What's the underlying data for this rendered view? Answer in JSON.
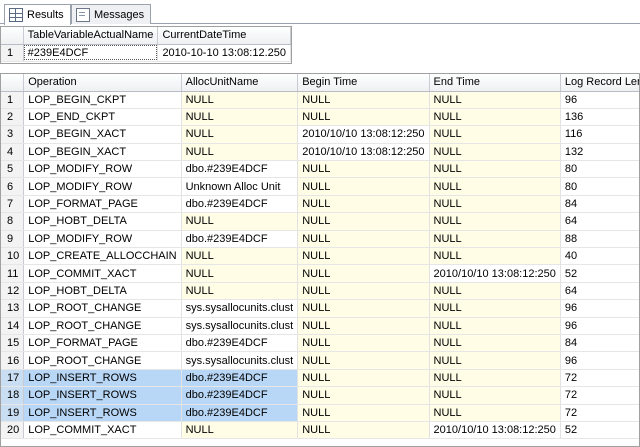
{
  "tabs": [
    {
      "label": "Results",
      "icon": "grid-icon",
      "active": true
    },
    {
      "label": "Messages",
      "icon": "messages-icon",
      "active": false
    }
  ],
  "grid1": {
    "columns": [
      "",
      "TableVariableActualName",
      "CurrentDateTime"
    ],
    "rows": [
      [
        "1",
        "#239E4DCF",
        "2010-10-10 13:08:12.250"
      ]
    ]
  },
  "grid2": {
    "columns": [
      "",
      "Operation",
      "AllocUnitName",
      "Begin Time",
      "End Time",
      "Log Record Length"
    ],
    "rows": [
      [
        "1",
        "LOP_BEGIN_CKPT",
        "NULL",
        "NULL",
        "NULL",
        "96"
      ],
      [
        "2",
        "LOP_END_CKPT",
        "NULL",
        "NULL",
        "NULL",
        "136"
      ],
      [
        "3",
        "LOP_BEGIN_XACT",
        "NULL",
        "2010/10/10 13:08:12:250",
        "NULL",
        "116"
      ],
      [
        "4",
        "LOP_BEGIN_XACT",
        "NULL",
        "2010/10/10 13:08:12:250",
        "NULL",
        "132"
      ],
      [
        "5",
        "LOP_MODIFY_ROW",
        "dbo.#239E4DCF",
        "NULL",
        "NULL",
        "80"
      ],
      [
        "6",
        "LOP_MODIFY_ROW",
        "Unknown Alloc Unit",
        "NULL",
        "NULL",
        "80"
      ],
      [
        "7",
        "LOP_FORMAT_PAGE",
        "dbo.#239E4DCF",
        "NULL",
        "NULL",
        "84"
      ],
      [
        "8",
        "LOP_HOBT_DELTA",
        "NULL",
        "NULL",
        "NULL",
        "64"
      ],
      [
        "9",
        "LOP_MODIFY_ROW",
        "dbo.#239E4DCF",
        "NULL",
        "NULL",
        "88"
      ],
      [
        "10",
        "LOP_CREATE_ALLOCCHAIN",
        "NULL",
        "NULL",
        "NULL",
        "40"
      ],
      [
        "11",
        "LOP_COMMIT_XACT",
        "NULL",
        "NULL",
        "2010/10/10 13:08:12:250",
        "52"
      ],
      [
        "12",
        "LOP_HOBT_DELTA",
        "NULL",
        "NULL",
        "NULL",
        "64"
      ],
      [
        "13",
        "LOP_ROOT_CHANGE",
        "sys.sysallocunits.clust",
        "NULL",
        "NULL",
        "96"
      ],
      [
        "14",
        "LOP_ROOT_CHANGE",
        "sys.sysallocunits.clust",
        "NULL",
        "NULL",
        "96"
      ],
      [
        "15",
        "LOP_FORMAT_PAGE",
        "dbo.#239E4DCF",
        "NULL",
        "NULL",
        "84"
      ],
      [
        "16",
        "LOP_ROOT_CHANGE",
        "sys.sysallocunits.clust",
        "NULL",
        "NULL",
        "96"
      ],
      [
        "17",
        "LOP_INSERT_ROWS",
        "dbo.#239E4DCF",
        "NULL",
        "NULL",
        "72"
      ],
      [
        "18",
        "LOP_INSERT_ROWS",
        "dbo.#239E4DCF",
        "NULL",
        "NULL",
        "72"
      ],
      [
        "19",
        "LOP_INSERT_ROWS",
        "dbo.#239E4DCF",
        "NULL",
        "NULL",
        "72"
      ],
      [
        "20",
        "LOP_COMMIT_XACT",
        "NULL",
        "NULL",
        "2010/10/10 13:08:12:250",
        "52"
      ]
    ],
    "selected_rows": [
      17,
      18,
      19
    ],
    "selected_columns": [
      1,
      2
    ]
  }
}
